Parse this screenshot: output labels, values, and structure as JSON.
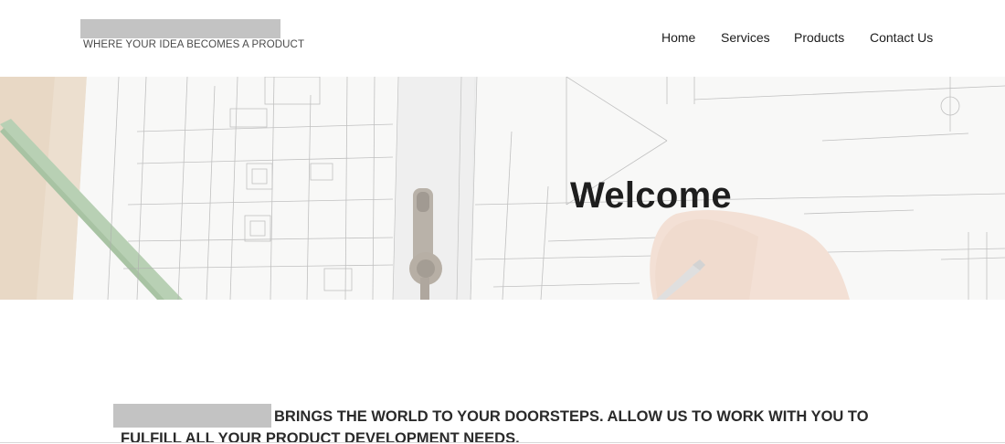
{
  "header": {
    "tagline": "WHERE YOUR IDEA BECOMES A PRODUCT",
    "nav": [
      {
        "label": "Home"
      },
      {
        "label": "Services"
      },
      {
        "label": "Products"
      },
      {
        "label": "Contact Us"
      }
    ]
  },
  "hero": {
    "title": "Welcome"
  },
  "intro": {
    "line1": "BRINGS THE WORLD TO YOUR DOORSTEPS. ALLOW US TO WORK WITH YOU TO",
    "line2": "FULFILL ALL YOUR PRODUCT DEVELOPMENT NEEDS."
  },
  "colors": {
    "redaction": "#c3c3c3",
    "text": "#1c1c1c",
    "hero_background": "#f4f4f2"
  }
}
